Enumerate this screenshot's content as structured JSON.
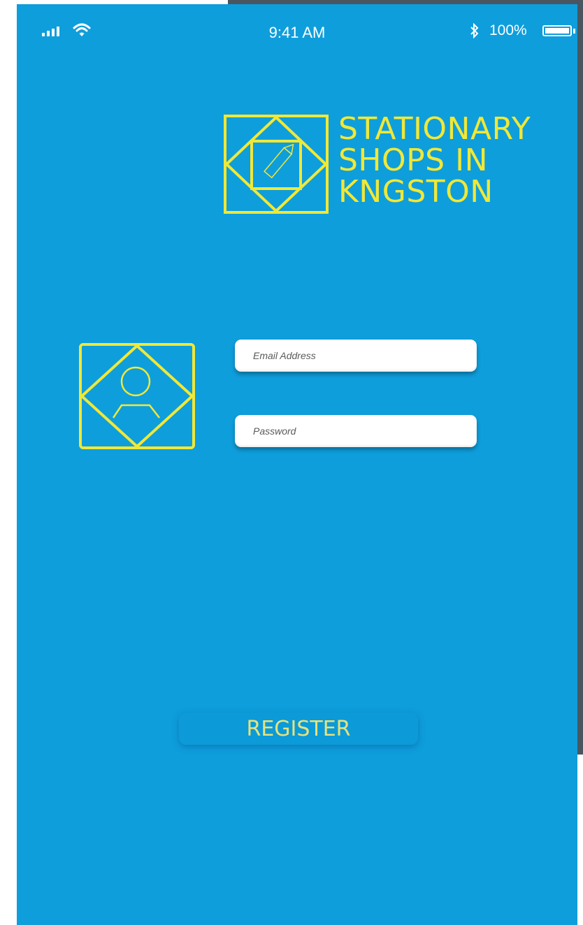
{
  "status_bar": {
    "time": "9:41 AM",
    "battery_percent": "100%",
    "bluetooth_glyph": "✱"
  },
  "brand": {
    "lines": [
      "STATIONARY",
      "SHOPS IN",
      "KNGSTON"
    ],
    "logo_icon": "pencil-diamond-logo-icon",
    "color": "#f1e836"
  },
  "avatar": {
    "icon": "user-diamond-icon"
  },
  "form": {
    "email_placeholder": "Email Address",
    "password_placeholder": "Password"
  },
  "actions": {
    "register_label": "REGISTER"
  },
  "colors": {
    "background": "#0e9edc",
    "accent": "#f1e836",
    "frame": "#4a5560"
  }
}
